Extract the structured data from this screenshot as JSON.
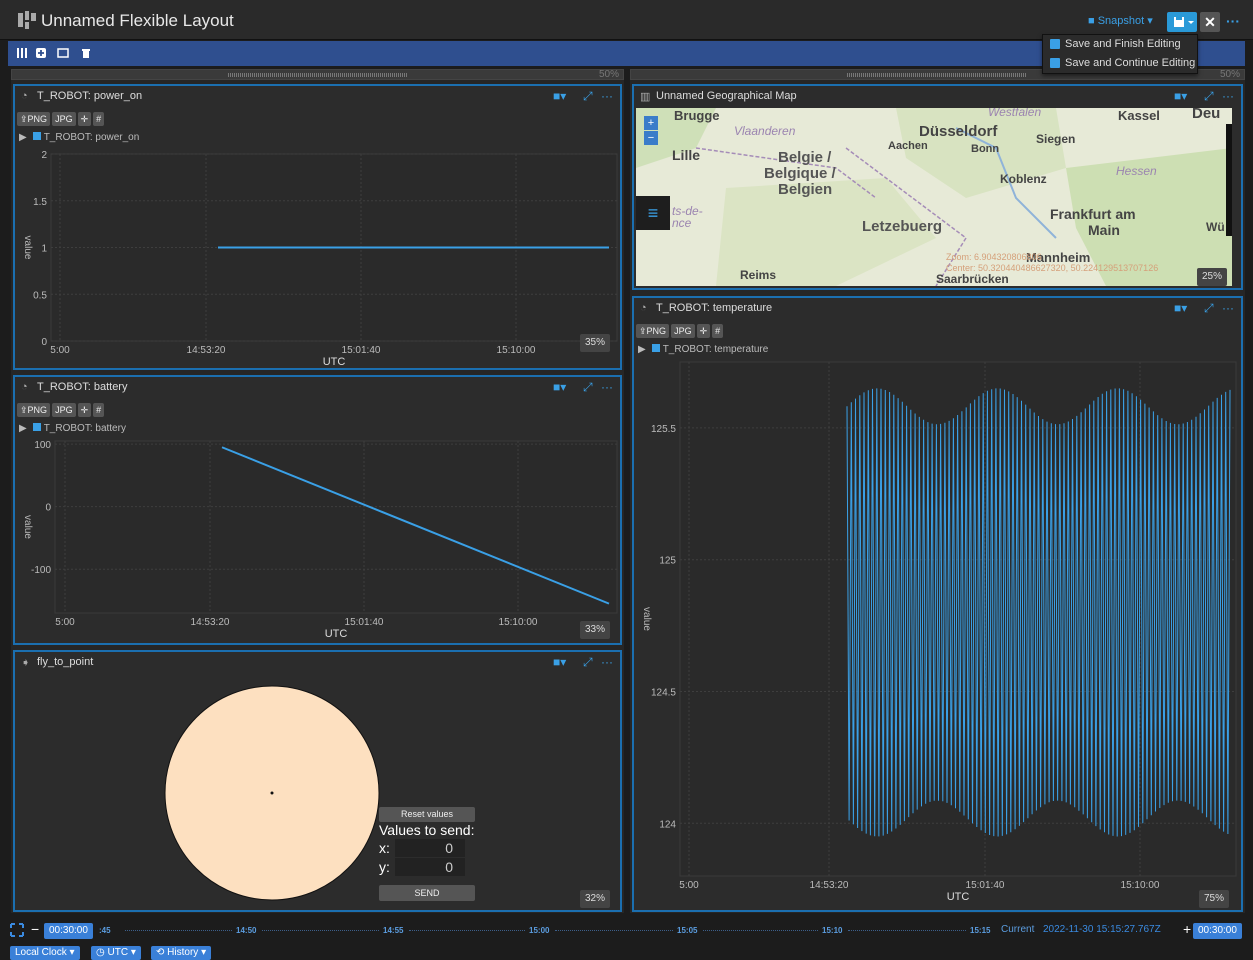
{
  "app": {
    "title": "Unnamed Flexible Layout",
    "snapshot_label": "Snapshot",
    "close_label": "✕",
    "more_label": "···"
  },
  "save_menu": {
    "items": [
      "Save and Finish Editing",
      "Save and Continue Editing"
    ]
  },
  "columns": {
    "left_pct": "50%",
    "right_pct": "50%"
  },
  "panels": {
    "power_on": {
      "title": "T_ROBOT: power_on",
      "buttons": [
        "PNG",
        "JPG"
      ],
      "legend": "T_ROBOT: power_on",
      "pct": "35%",
      "ylabel": "value",
      "xlabel": "UTC"
    },
    "battery": {
      "title": "T_ROBOT: battery",
      "buttons": [
        "PNG",
        "JPG"
      ],
      "legend": "T_ROBOT: battery",
      "pct": "33%",
      "ylabel": "value",
      "xlabel": "UTC"
    },
    "fly": {
      "title": "fly_to_point",
      "reset_label": "Reset values",
      "values_label": "Values to send:",
      "x_label": "x:",
      "y_label": "y:",
      "x_value": "0",
      "y_value": "0",
      "send_label": "SEND",
      "pct": "32%"
    },
    "map": {
      "title": "Unnamed Geographical Map",
      "pct": "25%",
      "zoom_in": "+",
      "zoom_out": "−",
      "labels": [
        "Brugge",
        "Vlaanderen",
        "Düsseldorf",
        "Westfalen",
        "Kassel",
        "Deu",
        "Aachen",
        "Bonn",
        "Siegen",
        "Lille",
        "Belgie /",
        "Belgique /",
        "Belgien",
        "Koblenz",
        "Hessen",
        "ts-de-",
        "nce",
        "Frankfurt am",
        "Main",
        "Letzebuerg",
        "Wü",
        "Reims",
        "Mannheim",
        "Saarbrücken"
      ],
      "info": [
        "Zoom: 6.904320806806",
        "Center: 50.320440486627320, 50.224129513707126"
      ]
    },
    "temperature": {
      "title": "T_ROBOT: temperature",
      "buttons": [
        "PNG",
        "JPG"
      ],
      "legend": "T_ROBOT: temperature",
      "pct": "75%",
      "ylabel": "value",
      "xlabel": "UTC"
    }
  },
  "chart_data": [
    {
      "type": "line",
      "name": "T_ROBOT: power_on",
      "x": [
        "14:50",
        "15:15"
      ],
      "values": [
        1,
        1
      ],
      "ylim": [
        0,
        2
      ],
      "yticks": [
        "0",
        "0.5",
        "1",
        "1.5",
        "2"
      ],
      "xticks": [
        "5:00",
        "14:53:20",
        "15:01:40",
        "15:10:00"
      ],
      "xlabel": "UTC",
      "ylabel": "value",
      "grid": true
    },
    {
      "type": "line",
      "name": "T_ROBOT: battery",
      "x": [
        "14:50",
        "15:15"
      ],
      "values": [
        95,
        -155
      ],
      "ylim": [
        -170,
        105
      ],
      "yticks": [
        "100",
        "0",
        "-100"
      ],
      "xticks": [
        "5:00",
        "14:53:20",
        "15:01:40",
        "15:10:00"
      ],
      "xlabel": "UTC",
      "ylabel": "value",
      "grid": true
    },
    {
      "type": "line",
      "name": "T_ROBOT: temperature",
      "x_range": [
        "14:50",
        "15:15"
      ],
      "oscillation": {
        "min": 123.95,
        "max": 125.65,
        "cycles": 90
      },
      "ylim": [
        123.8,
        125.75
      ],
      "yticks": [
        "125.5",
        "125",
        "124.5",
        "124"
      ],
      "xticks": [
        "5:00",
        "14:53:20",
        "15:01:40",
        "15:10:00"
      ],
      "xlabel": "UTC",
      "ylabel": "value",
      "grid": true
    }
  ],
  "timeline": {
    "duration_left": "00:30:00",
    "duration_right": "00:30:00",
    "ticks": [
      ":45",
      "14:50",
      "14:55",
      "15:00",
      "15:05",
      "15:10",
      "15:15"
    ],
    "current_label": "Current",
    "current_time": "2022-11-30 15:15:27.767Z",
    "minus": "−",
    "plus": "+"
  },
  "bottom": {
    "clock": "Local Clock",
    "tz": "UTC",
    "history": "History"
  }
}
